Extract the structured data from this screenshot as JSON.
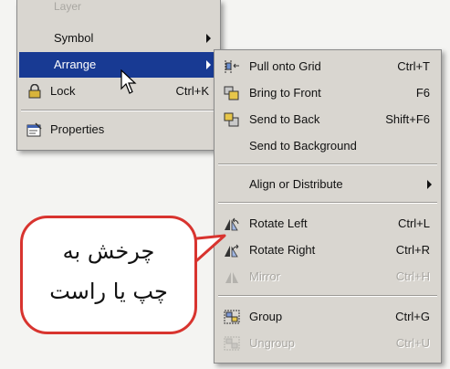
{
  "menu_main": {
    "faded_top_label": "Layer",
    "symbol_label": "Symbol",
    "arrange_label": "Arrange",
    "lock_label": "Lock",
    "lock_shortcut": "Ctrl+K",
    "properties_label": "Properties"
  },
  "submenu": {
    "pull_grid_label": "Pull onto Grid",
    "pull_grid_shortcut": "Ctrl+T",
    "bring_front_label": "Bring to Front",
    "bring_front_shortcut": "F6",
    "send_back_label": "Send to Back",
    "send_back_shortcut": "Shift+F6",
    "send_background_label": "Send to Background",
    "align_label": "Align or Distribute",
    "rotate_left_label": "Rotate Left",
    "rotate_left_shortcut": "Ctrl+L",
    "rotate_right_label": "Rotate Right",
    "rotate_right_shortcut": "Ctrl+R",
    "mirror_label": "Mirror",
    "mirror_shortcut": "Ctrl+H",
    "group_label": "Group",
    "group_shortcut": "Ctrl+G",
    "ungroup_label": "Ungroup",
    "ungroup_shortcut": "Ctrl+U"
  },
  "callout": {
    "line1": "چرخش به",
    "line2": "چپ یا راست"
  },
  "colors": {
    "highlight": "#183a93",
    "menu_bg": "#d9d6d0",
    "callout_border": "#d8342f"
  }
}
